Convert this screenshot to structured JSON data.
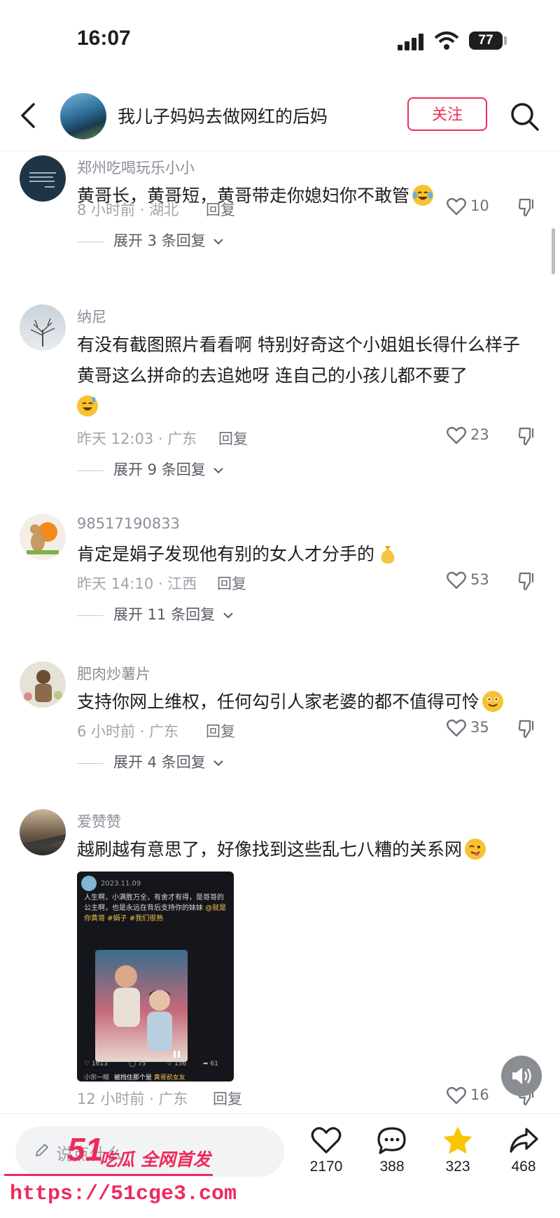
{
  "status_bar": {
    "time": "16:07",
    "battery": "77"
  },
  "header": {
    "title": "我儿子妈妈去做网红的后妈",
    "follow_label": "关注"
  },
  "comments": [
    {
      "user": "郑州吃喝玩乐小小",
      "text": "黄哥长，黄哥短，黄哥带走你媳妇你不敢管",
      "time_loc": "8 小时前 · 湖北",
      "reply": "回复",
      "likes": "10",
      "expand": "展开 3 条回复"
    },
    {
      "user": "纳尼",
      "text": "有没有截图照片看看啊  特别好奇这个小姐姐长得什么样子  黄哥这么拼命的去追她呀 连自己的小孩儿都不要了",
      "time_loc": "昨天 12:03 · 广东",
      "reply": "回复",
      "likes": "23",
      "expand": "展开 9 条回复"
    },
    {
      "user": "98517190833",
      "text": "肯定是娟子发现他有别的女人才分手的",
      "time_loc": "昨天 14:10 · 江西",
      "reply": "回复",
      "likes": "53",
      "expand": "展开 11 条回复"
    },
    {
      "user": "肥肉炒薯片",
      "text": "支持你网上维权，任何勾引人家老婆的都不值得可怜",
      "time_loc": "6 小时前 · 广东",
      "reply": "回复",
      "likes": "35",
      "expand": "展开 4 条回复"
    },
    {
      "user": "爱赞赞",
      "text": "越刷越有意思了，好像找到这些乱七八糟的关系网",
      "time_loc": "12 小时前 · 广东",
      "reply": "回复",
      "likes": "16",
      "expand": ""
    }
  ],
  "embedded_post": {
    "date": "2023.11.09",
    "body": "人生啊，小满胜万全，有舍才有得，是哥哥的公主啊，也是永远在背后支持你的妹妹",
    "tags": "@就是你黄哥 #娟子 #我们很熟",
    "stats": [
      "1613",
      "75",
      "156",
      "61"
    ],
    "footer_user": "小宗一眼",
    "footer_text": "被挡住那个是",
    "footer_highlight": "黄哥前女友"
  },
  "bottom_bar": {
    "input_placeholder": "说点什么",
    "likes": "2170",
    "comments": "388",
    "favorites": "323",
    "shares": "468"
  },
  "watermark": {
    "logo": "51",
    "text": "吃瓜 全网首发",
    "url": "https://51cge3.com"
  },
  "colors": {
    "accent": "#ee2e58",
    "star": "#f7c600",
    "muted": "#a0a4ab"
  }
}
